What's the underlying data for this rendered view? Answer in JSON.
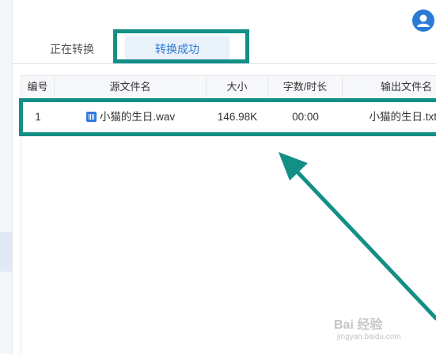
{
  "tabs": {
    "running_label": "正在转换",
    "success_label": "转换成功"
  },
  "table": {
    "columns": [
      "编号",
      "源文件名",
      "大小",
      "字数/时长",
      "输出文件名"
    ],
    "rows": [
      {
        "index": "1",
        "source": "小猫的生日.wav",
        "size": "146.98K",
        "duration": "00:00",
        "output": "小猫的生日.txt"
      }
    ]
  },
  "icons": {
    "user": "user-avatar-icon",
    "audio_file": "audio-file-icon"
  },
  "colors": {
    "accent": "#2a7bd6",
    "annotation": "#138f85"
  },
  "watermark": {
    "brand": "Bai 经验",
    "url": "jingyan.baidu.com"
  }
}
